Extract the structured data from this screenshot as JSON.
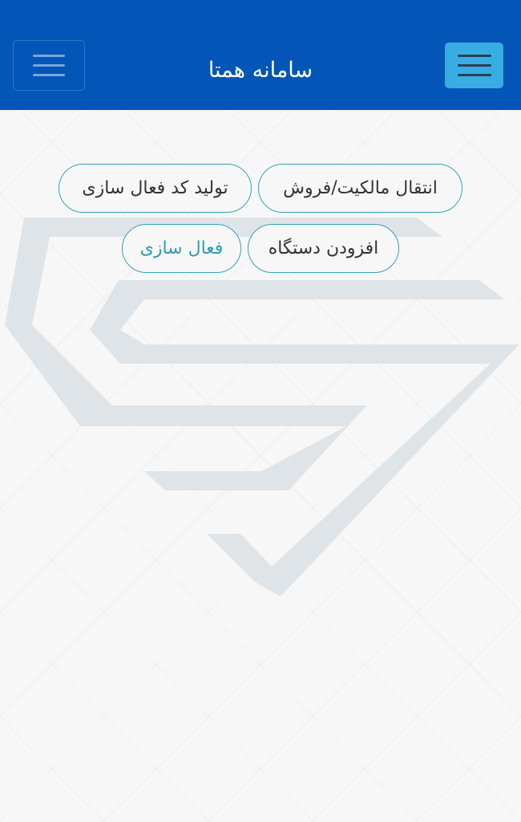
{
  "header": {
    "title": "سامانه همتا",
    "left_menu_icon": "hamburger-menu-icon",
    "right_menu_icon": "hamburger-menu-icon"
  },
  "actions": [
    {
      "label": "انتقال مالکیت/فروش"
    },
    {
      "label": "تولید کد فعال سازی"
    },
    {
      "label": "افزودن دستگاه"
    },
    {
      "label": "فعال سازی",
      "selected": true
    }
  ],
  "colors": {
    "header": "#0455b8",
    "menu_button_active": "#38ade3",
    "pill_border": "#33a4b3",
    "background": "#f7f7f7"
  }
}
